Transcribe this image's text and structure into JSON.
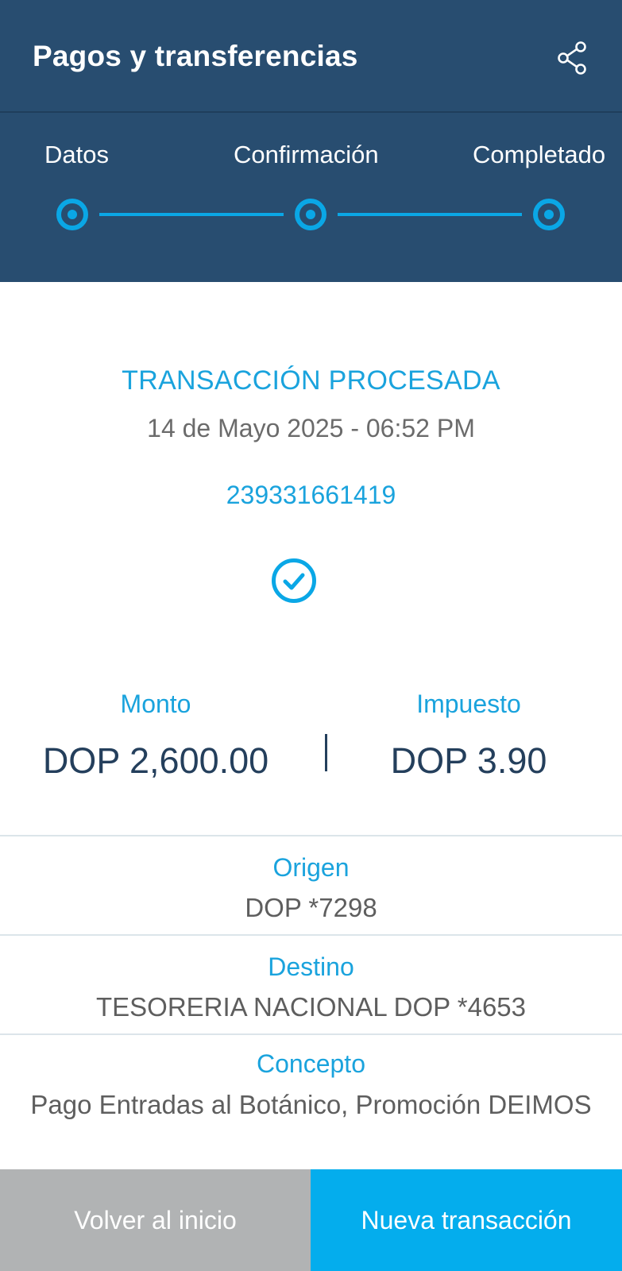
{
  "header": {
    "title": "Pagos y transferencias",
    "share_icon": "share-icon"
  },
  "stepper": {
    "steps": [
      {
        "label": "Datos",
        "state": "done"
      },
      {
        "label": "Confirmación",
        "state": "done"
      },
      {
        "label": "Completado",
        "state": "done"
      }
    ]
  },
  "status": {
    "title": "TRANSACCIÓN PROCESADA",
    "datetime": "14 de Mayo 2025 - 06:52 PM",
    "transaction_number": "239331661419",
    "icon": "check-circle-icon"
  },
  "amounts": {
    "monto_label": "Monto",
    "monto_value": "DOP 2,600.00",
    "impuesto_label": "Impuesto",
    "impuesto_value": "DOP 3.90"
  },
  "details": {
    "origen_label": "Origen",
    "origen_value": "DOP *7298",
    "destino_label": "Destino",
    "destino_value": "TESORERIA NACIONAL DOP *4653",
    "concepto_label": "Concepto",
    "concepto_value": "Pago Entradas al Botánico,  Promoción DEIMOS"
  },
  "actions": {
    "home_label": "Volver al inicio",
    "new_label": "Nueva transacción"
  },
  "colors": {
    "header_bg": "#284d70",
    "accent": "#0aa7e6",
    "primary_button": "#04aded",
    "secondary_button": "#b1b3b4"
  }
}
